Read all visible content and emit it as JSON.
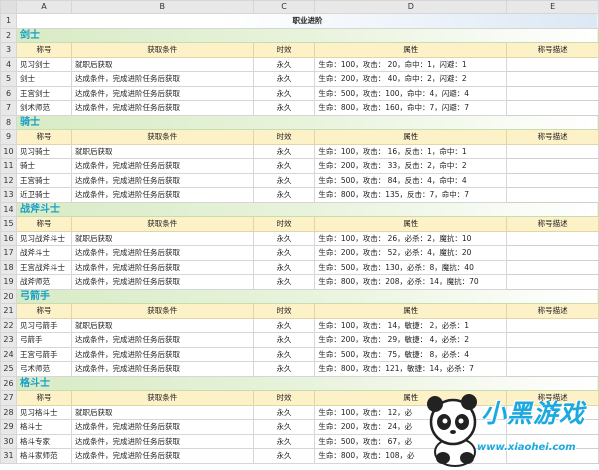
{
  "columns": [
    "A",
    "B",
    "C",
    "D",
    "E"
  ],
  "title": "职业进阶",
  "col_headers": {
    "name": "称号",
    "cond": "获取条件",
    "dur": "时效",
    "attr": "属性",
    "desc": "称号描述"
  },
  "sections": [
    {
      "row": 2,
      "title": "剑士",
      "header_row": 3,
      "rows": [
        {
          "n": 4,
          "name": "见习剑士",
          "cond": "就职后获取",
          "dur": "永久",
          "attr": "生命：100，攻击：  20，命中：1，闪避：1"
        },
        {
          "n": 5,
          "name": "剑士",
          "cond": "达成条件，完成进阶任务后获取",
          "dur": "永久",
          "attr": "生命：200，攻击：  40，命中：2，闪避：2"
        },
        {
          "n": 6,
          "name": "王宫剑士",
          "cond": "达成条件，完成进阶任务后获取",
          "dur": "永久",
          "attr": "生命：500，攻击：100，命中：4，闪避：4"
        },
        {
          "n": 7,
          "name": "剑术师范",
          "cond": "达成条件，完成进阶任务后获取",
          "dur": "永久",
          "attr": "生命：800，攻击：160，命中：7，闪避：7"
        }
      ]
    },
    {
      "row": 8,
      "title": "骑士",
      "header_row": 9,
      "rows": [
        {
          "n": 10,
          "name": "见习骑士",
          "cond": "就职后获取",
          "dur": "永久",
          "attr": "生命：100，攻击：  16，反击：1，命中：1"
        },
        {
          "n": 11,
          "name": "骑士",
          "cond": "达成条件，完成进阶任务后获取",
          "dur": "永久",
          "attr": "生命：200，攻击：  33，反击：2，命中：2"
        },
        {
          "n": 12,
          "name": "王宫骑士",
          "cond": "达成条件，完成进阶任务后获取",
          "dur": "永久",
          "attr": "生命：500，攻击：  84，反击：4，命中：4"
        },
        {
          "n": 13,
          "name": "近卫骑士",
          "cond": "达成条件，完成进阶任务后获取",
          "dur": "永久",
          "attr": "生命：800，攻击：135，反击：7，命中：7"
        }
      ]
    },
    {
      "row": 14,
      "title": "战斧斗士",
      "header_row": 15,
      "rows": [
        {
          "n": 16,
          "name": "见习战斧斗士",
          "cond": "就职后获取",
          "dur": "永久",
          "attr": "生命：100，攻击：  26，必杀：2，魔抗：10"
        },
        {
          "n": 17,
          "name": "战斧斗士",
          "cond": "达成条件，完成进阶任务后获取",
          "dur": "永久",
          "attr": "生命：200，攻击：  52，必杀：4，魔抗：20"
        },
        {
          "n": 18,
          "name": "王宫战斧斗士",
          "cond": "达成条件，完成进阶任务后获取",
          "dur": "永久",
          "attr": "生命：500，攻击：130，必杀：8，魔抗：40"
        },
        {
          "n": 19,
          "name": "战斧师范",
          "cond": "达成条件，完成进阶任务后获取",
          "dur": "永久",
          "attr": "生命：800，攻击：208，必杀：14，魔抗：70"
        }
      ]
    },
    {
      "row": 20,
      "title": "弓箭手",
      "header_row": 21,
      "rows": [
        {
          "n": 22,
          "name": "见习弓箭手",
          "cond": "就职后获取",
          "dur": "永久",
          "attr": "生命：100，攻击：  14，敏捷：  2，必杀：1"
        },
        {
          "n": 23,
          "name": "弓箭手",
          "cond": "达成条件，完成进阶任务后获取",
          "dur": "永久",
          "attr": "生命：200，攻击：  29，敏捷：  4，必杀：2"
        },
        {
          "n": 24,
          "name": "王宫弓箭手",
          "cond": "达成条件，完成进阶任务后获取",
          "dur": "永久",
          "attr": "生命：500，攻击：  75，敏捷：  8，必杀：4"
        },
        {
          "n": 25,
          "name": "弓术师范",
          "cond": "达成条件，完成进阶任务后获取",
          "dur": "永久",
          "attr": "生命：800，攻击：121，敏捷：14，必杀：7"
        }
      ]
    },
    {
      "row": 26,
      "title": "格斗士",
      "header_row": 27,
      "rows": [
        {
          "n": 28,
          "name": "见习格斗士",
          "cond": "就职后获取",
          "dur": "永久",
          "attr": "生命：100，攻击：  12，必"
        },
        {
          "n": 29,
          "name": "格斗士",
          "cond": "达成条件，完成进阶任务后获取",
          "dur": "永久",
          "attr": "生命：200，攻击：  24，必"
        },
        {
          "n": 30,
          "name": "格斗专家",
          "cond": "达成条件，完成进阶任务后获取",
          "dur": "永久",
          "attr": "生命：500，攻击：  67，必"
        },
        {
          "n": 31,
          "name": "格斗家师范",
          "cond": "达成条件，完成进阶任务后获取",
          "dur": "永久",
          "attr": "生命：800，攻击：108，必"
        }
      ]
    }
  ],
  "watermark": {
    "text": "小黑游戏",
    "url": "www.xiaohei.com",
    "brand_color": "#1ca9e0"
  }
}
